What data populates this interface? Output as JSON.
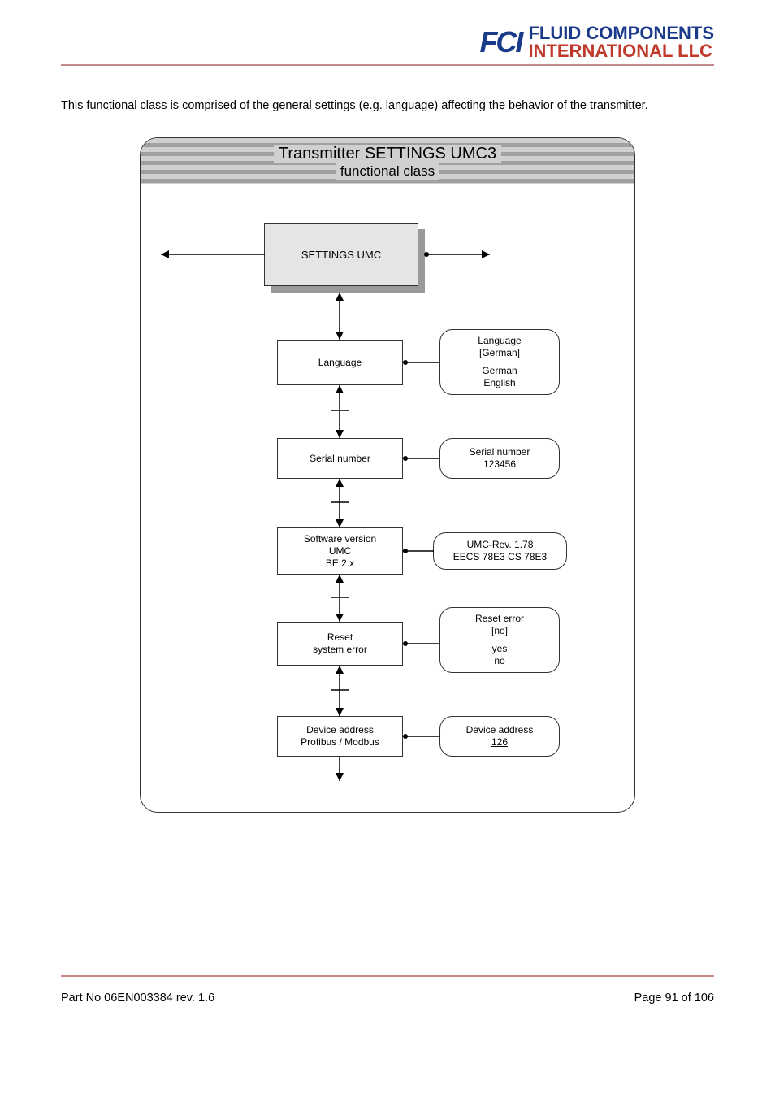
{
  "logo": {
    "mark": "FCI",
    "line1": "FLUID COMPONENTS",
    "line2": "INTERNATIONAL LLC"
  },
  "intro": "This functional class is comprised of the general settings (e.g. language) affecting the behavior of the transmitter.",
  "diagram": {
    "title": "Transmitter SETTINGS UMC3",
    "subtitle": "functional class",
    "main": "SETTINGS UMC",
    "nodes": {
      "language": {
        "label": "Language",
        "detail_title": "Language",
        "detail_current": "[German]",
        "options": [
          "German",
          "English"
        ]
      },
      "serial": {
        "label": "Serial number",
        "detail_title": "Serial number",
        "detail_value": "123456"
      },
      "software": {
        "label_l1": "Software version",
        "label_l2": "UMC",
        "label_l3": "BE 2.x",
        "detail_l1": "UMC-Rev. 1.78",
        "detail_l2": "EECS 78E3 CS 78E3"
      },
      "reset": {
        "label_l1": "Reset",
        "label_l2": "system error",
        "detail_title": "Reset error",
        "detail_current": "[no]",
        "options": [
          "yes",
          "no"
        ]
      },
      "devaddr": {
        "label_l1": "Device address",
        "label_l2": "Profibus / Modbus",
        "detail_title": "Device address",
        "detail_value": "126"
      }
    }
  },
  "footer": {
    "page": "Page 91 of 106",
    "part": "Part No 06EN003384 rev. 1.6"
  },
  "chart_data": {
    "type": "diagram",
    "title": "Transmitter SETTINGS UMC3 functional class",
    "root": "SETTINGS UMC",
    "children": [
      {
        "name": "Language",
        "detail": {
          "current": "German",
          "options": [
            "German",
            "English"
          ]
        }
      },
      {
        "name": "Serial number",
        "detail": {
          "value": "123456"
        }
      },
      {
        "name": "Software version UMC BE 2.x",
        "detail": {
          "values": [
            "UMC-Rev. 1.78",
            "EECS 78E3 CS 78E3"
          ]
        }
      },
      {
        "name": "Reset system error",
        "detail": {
          "current": "no",
          "options": [
            "yes",
            "no"
          ]
        }
      },
      {
        "name": "Device address Profibus / Modbus",
        "detail": {
          "value": "126"
        }
      }
    ]
  }
}
